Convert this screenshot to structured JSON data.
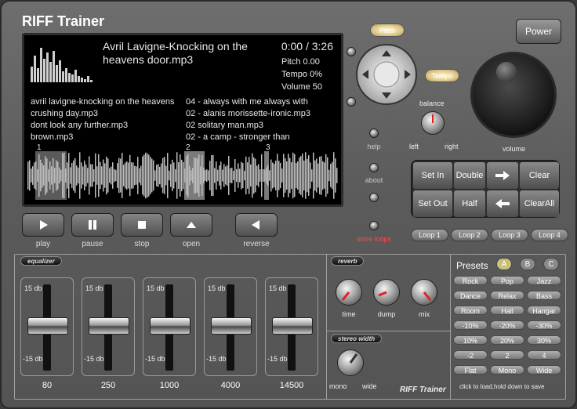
{
  "app": {
    "title": "RIFF Trainer",
    "brand_label": "RIFF Trainer"
  },
  "display": {
    "song_title": "Avril Lavigne-Knocking on the heavens door.mp3",
    "time": "0:00 / 3:26",
    "pitch": "Pitch 0.00",
    "tempo": "Tempo 0%",
    "volume": "Volume 50",
    "playlist_left": [
      "avril lavigne-knocking on the heavens",
      "crushing day.mp3",
      "dont look any further.mp3",
      "brown.mp3"
    ],
    "playlist_right": [
      "04 - always with me always with",
      "02 - alanis morissette-ironic.mp3",
      "02 solitary man.mp3",
      "02 - a camp - stronger than"
    ],
    "markers": [
      "1",
      "2",
      "3"
    ]
  },
  "side_buttons": {
    "help": "help",
    "about": "about",
    "store_loops": "store loops"
  },
  "transport": {
    "play": "play",
    "pause": "pause",
    "stop": "stop",
    "open": "open",
    "reverse": "reverse"
  },
  "controls": {
    "pitch": "Pitch",
    "tempo": "Tempo",
    "power": "Power",
    "balance": "balance",
    "left": "left",
    "right": "right",
    "volume": "volume"
  },
  "loop_grid": {
    "set_in": "Set In",
    "double": "Double",
    "clear": "Clear",
    "set_out": "Set Out",
    "half": "Half",
    "clear_all": "ClearAll"
  },
  "loops": [
    "Loop 1",
    "Loop 2",
    "Loop 3",
    "Loop 4"
  ],
  "equalizer": {
    "label": "equalizer",
    "top_label": "15 db",
    "bottom_label": "-15 db",
    "bands": [
      "80",
      "250",
      "1000",
      "4000",
      "14500"
    ]
  },
  "reverb": {
    "label": "reverb",
    "time": "time",
    "dump": "dump",
    "mix": "mix"
  },
  "stereo": {
    "label": "stereo width",
    "mono": "mono",
    "wide": "wide"
  },
  "presets": {
    "title": "Presets",
    "banks": [
      "A",
      "B",
      "C"
    ],
    "items": [
      "Rock",
      "Pop",
      "Jazz",
      "Dance",
      "Relax",
      "Bass",
      "Room",
      "Hall",
      "Hangar",
      "-10%",
      "-20%",
      "-30%",
      "10%",
      "20%",
      "30%",
      "-2",
      "2",
      "4",
      "Flat",
      "Mono",
      "Wide"
    ],
    "hint": "click to load,hold down to save"
  },
  "colors": {
    "pitch_pill": "#e0c98a",
    "store_loops": "#ff4a4a",
    "bank_a": "#c9c07a",
    "bank_bc": "#8a8a8a"
  }
}
